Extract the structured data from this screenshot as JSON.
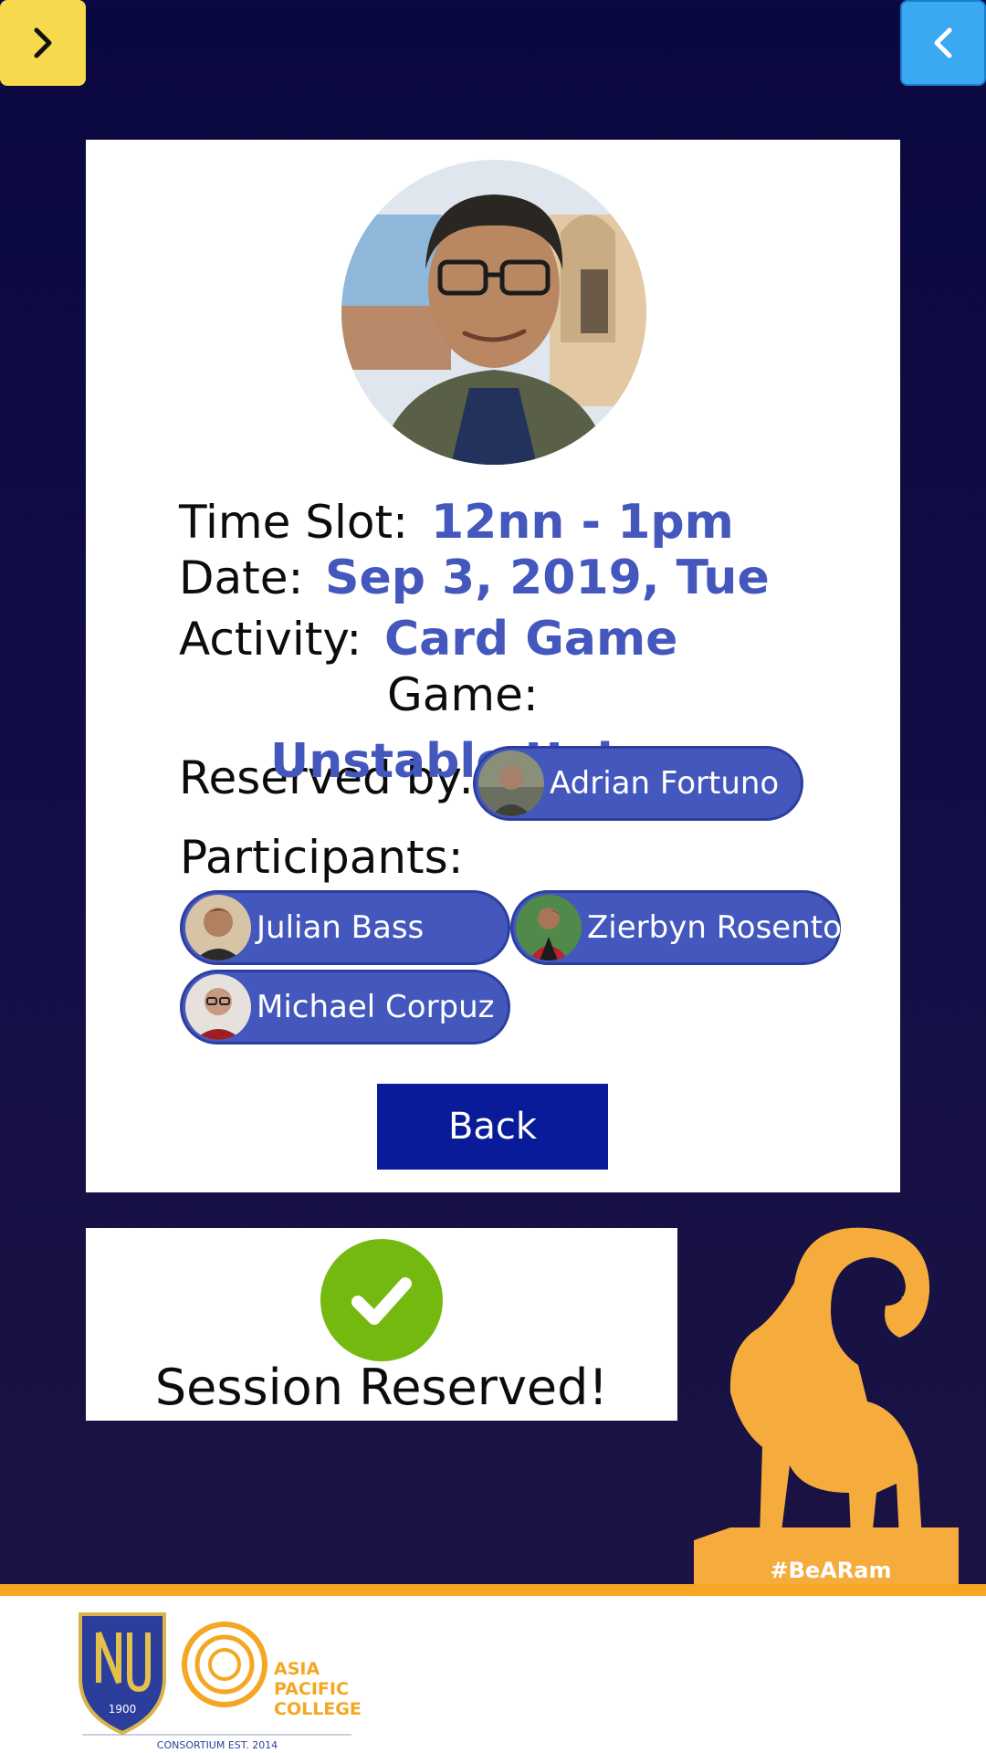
{
  "nav": {
    "left_icon": "chevron-right-icon",
    "right_icon": "chevron-left-icon"
  },
  "reservation": {
    "time_slot_label": "Time Slot:",
    "time_slot_value": "12nn - 1pm",
    "date_label": "Date:",
    "date_value": "Sep 3, 2019, Tue",
    "activity_label": "Activity:",
    "activity_value": "Card Game",
    "game_label": "Game:",
    "game_value": "Unstable Uni",
    "reserved_by_label": "Reserved by:",
    "reserved_by": "Adrian Fortuno",
    "participants_label": "Participants:",
    "participants": [
      "Julian Bass",
      "Zierbyn Rosento",
      "Michael Corpuz"
    ],
    "back_label": "Back"
  },
  "toast": {
    "message": "Session Reserved!",
    "icon": "check-icon"
  },
  "mascot": {
    "hashtag": "#BeARam"
  },
  "footer": {
    "logo_left_text": "1900",
    "logo_right_text_1": "ASIA",
    "logo_right_text_2": "PACIFIC",
    "logo_right_text_3": "COLLEGE",
    "consortium": "CONSORTIUM EST. 2014"
  },
  "colors": {
    "accent_blue": "#4357bd",
    "button_navy": "#0a1b9a",
    "check_green": "#74b90f",
    "brand_orange": "#f5a623",
    "nav_yellow": "#f7d94e",
    "nav_blue": "#3aa9f2"
  }
}
